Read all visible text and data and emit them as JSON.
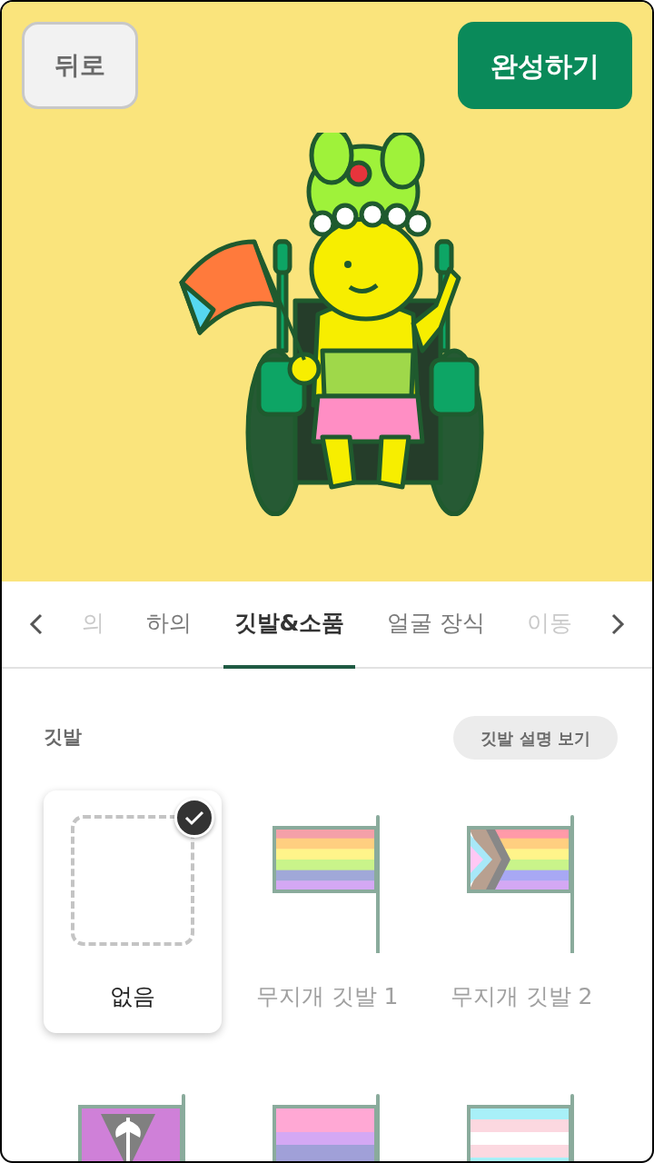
{
  "header": {
    "back_button": "뒤로",
    "done_button": "완성하기"
  },
  "tabs": [
    {
      "label": "의",
      "selected": false,
      "faded": true
    },
    {
      "label": "하의",
      "selected": false,
      "faded": false
    },
    {
      "label": "깃발&소품",
      "selected": true,
      "faded": false
    },
    {
      "label": "얼굴 장식",
      "selected": false,
      "faded": false
    },
    {
      "label": "이동",
      "selected": false,
      "faded": true
    }
  ],
  "section": {
    "title": "깃발",
    "info_button": "깃발 설명 보기"
  },
  "items": [
    {
      "kind": "none",
      "label": "없음",
      "selected": true
    },
    {
      "kind": "rainbow",
      "label": "무지개 깃발 1",
      "selected": false
    },
    {
      "kind": "progress",
      "label": "무지개 깃발 2",
      "selected": false
    },
    {
      "kind": "lesbian",
      "selected": false
    },
    {
      "kind": "bisexual",
      "selected": false
    },
    {
      "kind": "transgender",
      "selected": false
    }
  ]
}
